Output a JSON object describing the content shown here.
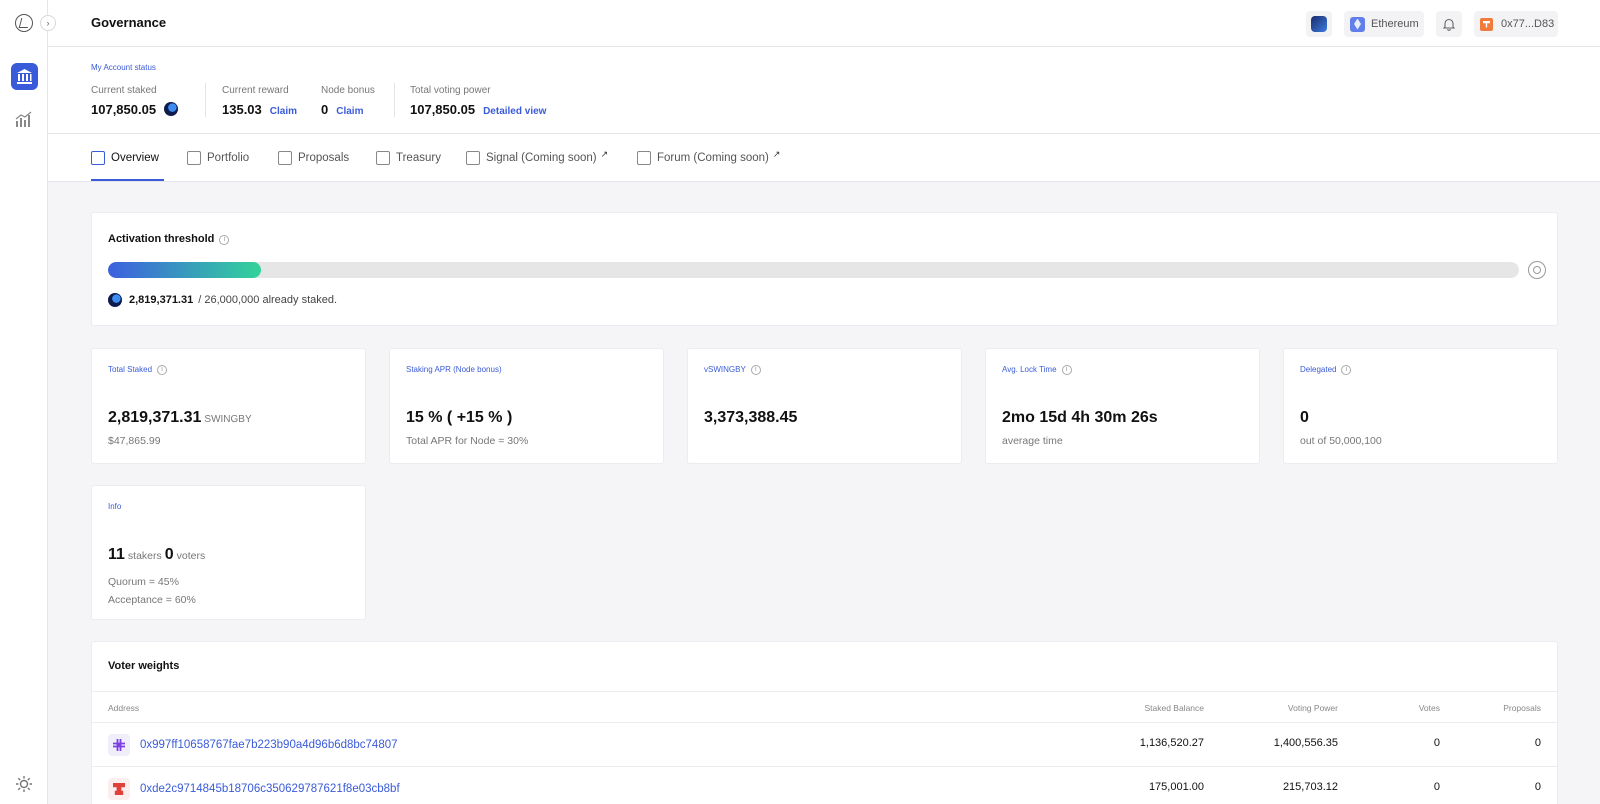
{
  "header": {
    "title": "Governance",
    "network": "Ethereum",
    "account": "0x77...D83"
  },
  "account_status": {
    "title": "My Account status",
    "current_staked_label": "Current staked",
    "current_staked": "107,850.05",
    "current_reward_label": "Current reward",
    "current_reward": "135.03",
    "claim_label": "Claim",
    "node_bonus_label": "Node bonus",
    "node_bonus": "0",
    "total_voting_power_label": "Total voting power",
    "total_voting_power": "107,850.05",
    "detailed_view_label": "Detailed view"
  },
  "tabs": [
    {
      "label": "Overview",
      "icon": "chart-icon",
      "active": true
    },
    {
      "label": "Portfolio",
      "icon": "wallet-icon"
    },
    {
      "label": "Proposals",
      "icon": "document-icon"
    },
    {
      "label": "Treasury",
      "icon": "safe-icon"
    },
    {
      "label": "Signal (Coming soon)",
      "icon": "chat-icon",
      "external": true
    },
    {
      "label": "Forum (Coming soon)",
      "icon": "forum-icon",
      "external": true
    }
  ],
  "threshold": {
    "title": "Activation threshold",
    "staked": "2,819,371.31",
    "target_text": "/ 26,000,000 already staked.",
    "progress_fraction": 0.1084
  },
  "stats": [
    {
      "label": "Total Staked",
      "value": "2,819,371.31",
      "unit": "SWINGBY",
      "sub": "$47,865.99"
    },
    {
      "label": "Staking APR (Node bonus)",
      "value": "15 % ( +15 % )",
      "unit": "",
      "sub": "Total APR for Node = 30%"
    },
    {
      "label": "vSWINGBY",
      "value": "3,373,388.45",
      "unit": "",
      "sub": ""
    },
    {
      "label": "Avg. Lock Time",
      "value": "2mo 15d 4h 30m 26s",
      "unit": "",
      "sub": "average time"
    },
    {
      "label": "Delegated",
      "value": "0",
      "unit": "",
      "sub": "out of 50,000,100"
    }
  ],
  "info": {
    "title": "Info",
    "stakers": "11",
    "stakers_label": "stakers",
    "voters": "0",
    "voters_label": "voters",
    "quorum": "Quorum = 45%",
    "acceptance": "Acceptance = 60%"
  },
  "voter_weights": {
    "title": "Voter weights",
    "columns": [
      "Address",
      "Staked Balance",
      "Voting Power",
      "Votes",
      "Proposals"
    ],
    "rows": [
      {
        "address": "0x997ff10658767fae7b223b90a4d96b6d8bc74807",
        "staked": "1,136,520.27",
        "power": "1,400,556.35",
        "votes": "0",
        "proposals": "0"
      },
      {
        "address": "0xde2c9714845b18706c350629787621f8e03cb8bf",
        "staked": "175,001.00",
        "power": "215,703.12",
        "votes": "0",
        "proposals": "0"
      }
    ]
  },
  "colors": {
    "accent": "#3a5bd9",
    "progress_start": "#3d5fe0",
    "progress_end": "#33d39a"
  }
}
